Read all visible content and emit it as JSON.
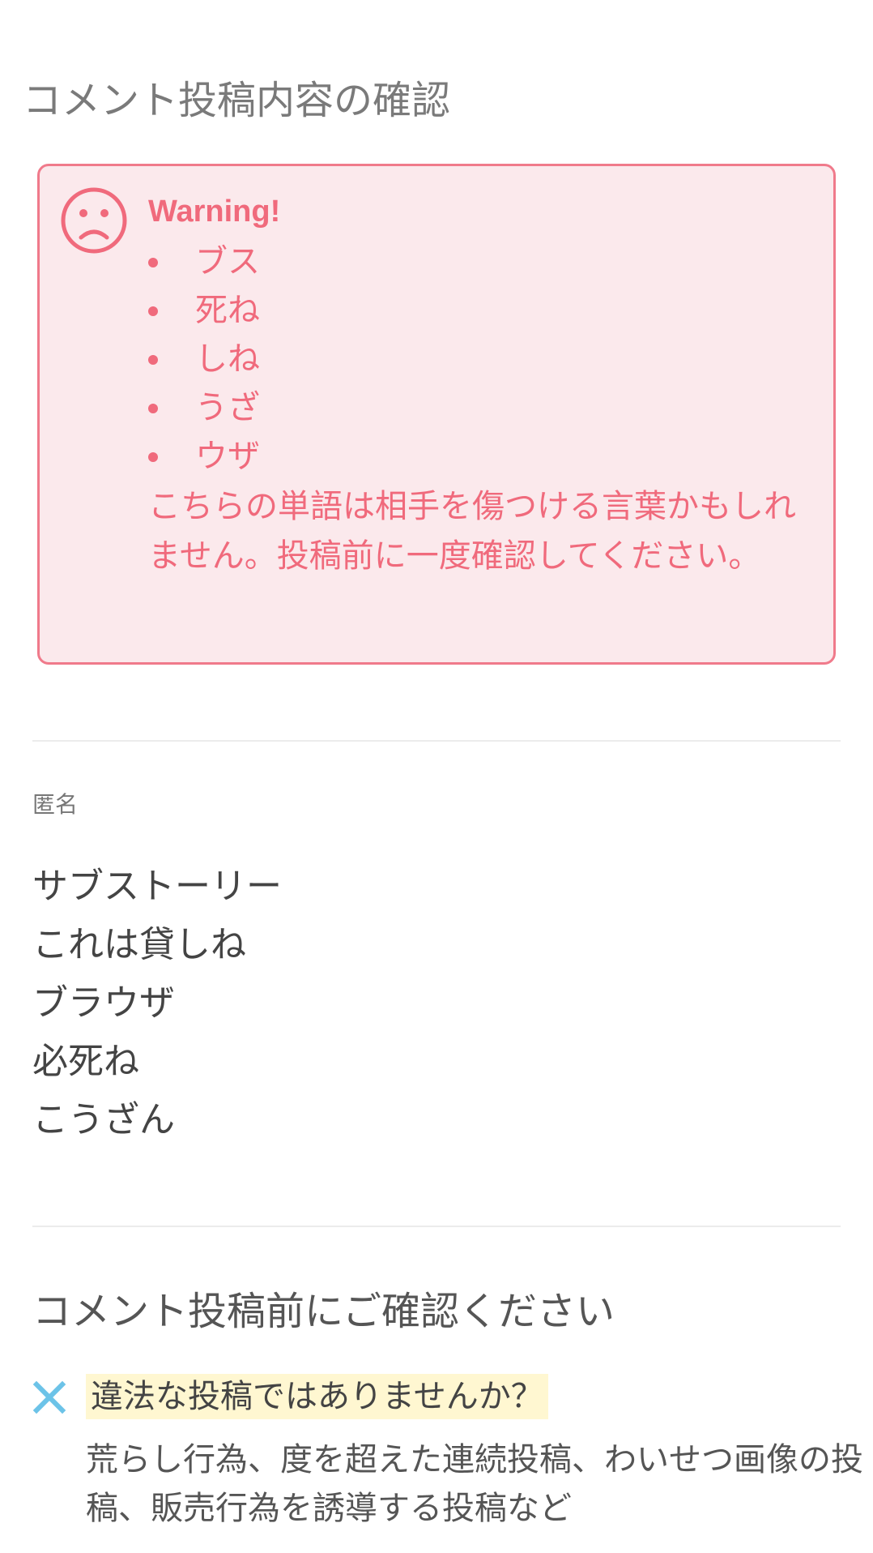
{
  "page": {
    "title": "コメント投稿内容の確認"
  },
  "warning": {
    "icon": "sad-face-icon",
    "heading": "Warning!",
    "words": [
      "ブス",
      "死ね",
      "しね",
      "うざ",
      "ウザ"
    ],
    "message": "こちらの単語は相手を傷つける言葉かもしれません。投稿前に一度確認してください。",
    "colors": {
      "text": "#f06a7c",
      "background": "#fbe9ec",
      "border": "#f07a8b"
    }
  },
  "comment": {
    "author": "匿名",
    "lines": [
      "サブストーリー",
      "これは貸しね",
      "ブラウザ",
      "必死ね",
      "こうざん"
    ]
  },
  "notice": {
    "title": "コメント投稿前にご確認ください",
    "items": [
      {
        "icon": "cross-icon",
        "question": "違法な投稿ではありませんか？",
        "description": "荒らし行為、度を超えた連続投稿、わいせつ画像の投稿、販売行為を誘導する投稿など"
      }
    ]
  }
}
